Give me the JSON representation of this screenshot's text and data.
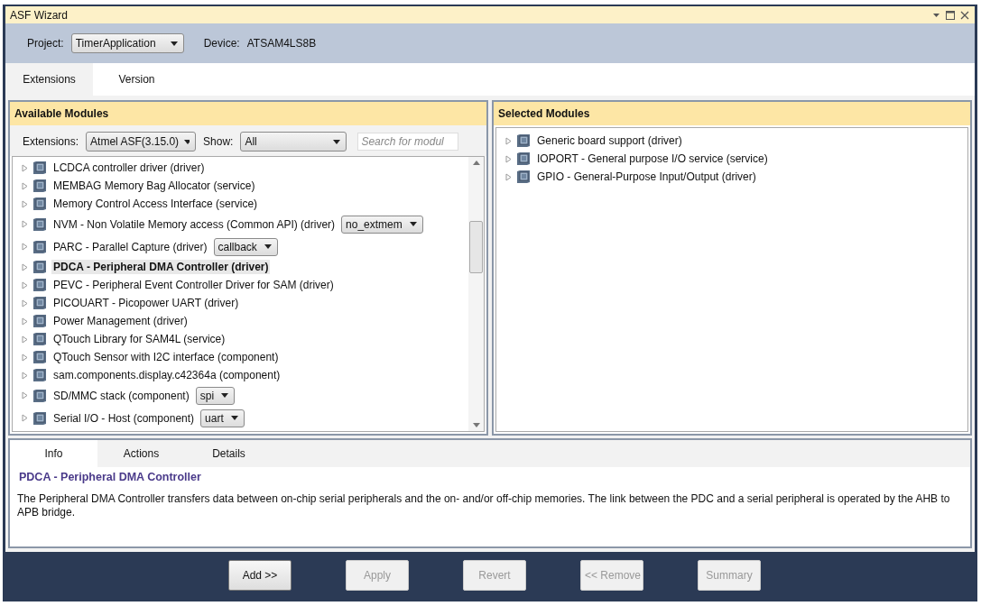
{
  "window": {
    "title": "ASF Wizard"
  },
  "project": {
    "label": "Project:",
    "value": "TimerApplication"
  },
  "device": {
    "label": "Device:",
    "value": "ATSAM4LS8B"
  },
  "tabs": [
    {
      "label": "Extensions",
      "selected": true
    },
    {
      "label": "Version",
      "selected": false
    }
  ],
  "available": {
    "title": "Available Modules",
    "extensions_label": "Extensions:",
    "extensions_value": "Atmel ASF(3.15.0)",
    "show_label": "Show:",
    "show_value": "All",
    "search_placeholder": "Search for modul",
    "modules": [
      {
        "label": "LCDCA controller driver (driver)",
        "selected": false
      },
      {
        "label": "MEMBAG Memory Bag Allocator (service)",
        "selected": false
      },
      {
        "label": "Memory Control Access Interface (service)",
        "selected": false
      },
      {
        "label": "NVM - Non Volatile Memory access (Common API) (driver)",
        "selected": false,
        "option": "no_extmem"
      },
      {
        "label": "PARC - Parallel Capture (driver)",
        "selected": false,
        "option": "callback"
      },
      {
        "label": "PDCA - Peripheral DMA Controller (driver)",
        "selected": true
      },
      {
        "label": "PEVC - Peripheral Event Controller Driver for SAM (driver)",
        "selected": false
      },
      {
        "label": "PICOUART - Picopower UART (driver)",
        "selected": false
      },
      {
        "label": "Power Management (driver)",
        "selected": false
      },
      {
        "label": "QTouch Library for SAM4L (service)",
        "selected": false
      },
      {
        "label": "QTouch Sensor with I2C interface (component)",
        "selected": false
      },
      {
        "label": "sam.components.display.c42364a (component)",
        "selected": false
      },
      {
        "label": "SD/MMC stack (component)",
        "selected": false,
        "option": "spi"
      },
      {
        "label": "Serial I/O - Host (component)",
        "selected": false,
        "option": "uart"
      }
    ]
  },
  "selected_modules": {
    "title": "Selected Modules",
    "modules": [
      {
        "label": "Generic board support (driver)"
      },
      {
        "label": "IOPORT - General purpose I/O service (service)"
      },
      {
        "label": "GPIO - General-Purpose Input/Output (driver)"
      }
    ]
  },
  "info": {
    "tabs": [
      {
        "label": "Info",
        "selected": true
      },
      {
        "label": "Actions",
        "selected": false
      },
      {
        "label": "Details",
        "selected": false
      }
    ],
    "heading": "PDCA - Peripheral DMA Controller",
    "description": "The Peripheral DMA Controller transfers data between on-chip serial peripherals and the on- and/or off-chip memories. The link between the PDC and a serial peripheral is operated by the AHB to APB bridge."
  },
  "buttons": [
    {
      "label": "Add >>",
      "disabled": false
    },
    {
      "label": "Apply",
      "disabled": true
    },
    {
      "label": "Revert",
      "disabled": true
    },
    {
      "label": "<< Remove",
      "disabled": true
    },
    {
      "label": "Summary",
      "disabled": true
    }
  ]
}
